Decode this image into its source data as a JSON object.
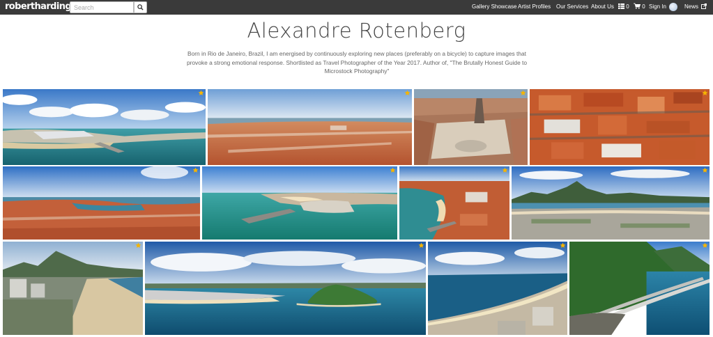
{
  "nav": {
    "logo": "robertharding",
    "search_placeholder": "Search",
    "links": {
      "gallery_showcase": "Gallery Showcase",
      "artist_profiles": "Artist Profiles",
      "our_services": "Our Services",
      "about_us": "About Us",
      "lightbox_count": "0",
      "cart_count": "0",
      "sign_in": "Sign In",
      "news": "News"
    }
  },
  "artist": {
    "name": "Alexandre Rotenberg",
    "bio": "Born in Rio de Janeiro, Brazil, I am energised by continuously exploring new places (preferably on a bicycle) to capture images that provoke a strong emotional response. Shortlisted as Travel Photographer of the Year 2017. Author of, \"The Brutally Honest Guide to Microstock Photography\""
  },
  "colors": {
    "nav_bg": "#3a3a3a",
    "star": "#f5b400",
    "title": "#444444",
    "bio": "#666666"
  },
  "icons": {
    "search": "magnifier-icon",
    "lightbox": "grid-icon",
    "cart": "cart-icon",
    "news": "external-link-icon",
    "favourite": "star-icon"
  }
}
